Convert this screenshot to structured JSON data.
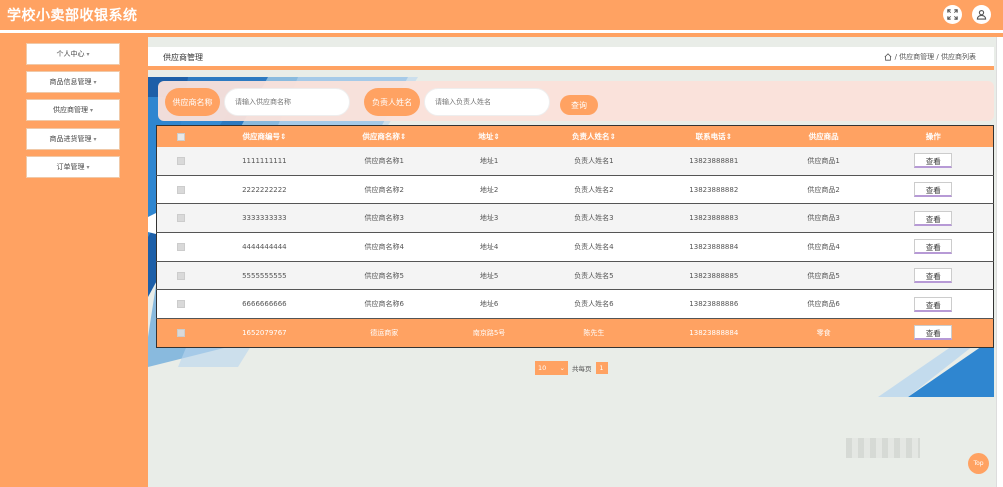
{
  "app": {
    "title": "学校小卖部收银系统",
    "accent_color": "#ffa262",
    "header_icons": [
      "fullscreen-icon",
      "user-icon"
    ]
  },
  "sidebar": {
    "items": [
      {
        "label": "个人中心"
      },
      {
        "label": "商品信息管理"
      },
      {
        "label": "供应商管理"
      },
      {
        "label": "商品进货管理"
      },
      {
        "label": "订单管理"
      }
    ]
  },
  "breadcrumb": {
    "title": "供应商管理",
    "path": "/ 供应商管理 / 供应商列表"
  },
  "search": {
    "supplier_label": "供应商名称",
    "supplier_placeholder": "请输入供应商名称",
    "contact_label": "负责人姓名",
    "contact_placeholder": "请输入负责人姓名",
    "button_label": "查询"
  },
  "table": {
    "columns": [
      "供应商编号",
      "供应商名称",
      "地址",
      "负责人姓名",
      "联系电话",
      "供应商品",
      "操作"
    ],
    "rows": [
      {
        "id": "1111111111",
        "name": "供应商名称1",
        "address": "地址1",
        "contact": "负责人姓名1",
        "phone": "13823888881",
        "goods": "供应商品1",
        "action": "查看"
      },
      {
        "id": "2222222222",
        "name": "供应商名称2",
        "address": "地址2",
        "contact": "负责人姓名2",
        "phone": "13823888882",
        "goods": "供应商品2",
        "action": "查看"
      },
      {
        "id": "3333333333",
        "name": "供应商名称3",
        "address": "地址3",
        "contact": "负责人姓名3",
        "phone": "13823888883",
        "goods": "供应商品3",
        "action": "查看"
      },
      {
        "id": "4444444444",
        "name": "供应商名称4",
        "address": "地址4",
        "contact": "负责人姓名4",
        "phone": "13823888884",
        "goods": "供应商品4",
        "action": "查看"
      },
      {
        "id": "5555555555",
        "name": "供应商名称5",
        "address": "地址5",
        "contact": "负责人姓名5",
        "phone": "13823888885",
        "goods": "供应商品5",
        "action": "查看"
      },
      {
        "id": "6666666666",
        "name": "供应商名称6",
        "address": "地址6",
        "contact": "负责人姓名6",
        "phone": "13823888886",
        "goods": "供应商品6",
        "action": "查看"
      },
      {
        "id": "1652079767",
        "name": "德运商家",
        "address": "南京路5号",
        "contact": "陈先生",
        "phone": "13823888884",
        "goods": "零食",
        "action": "查看"
      }
    ]
  },
  "pagination": {
    "page_size": "10",
    "total_label": "共每页",
    "current_page": "1"
  },
  "back_to_top": "Top"
}
